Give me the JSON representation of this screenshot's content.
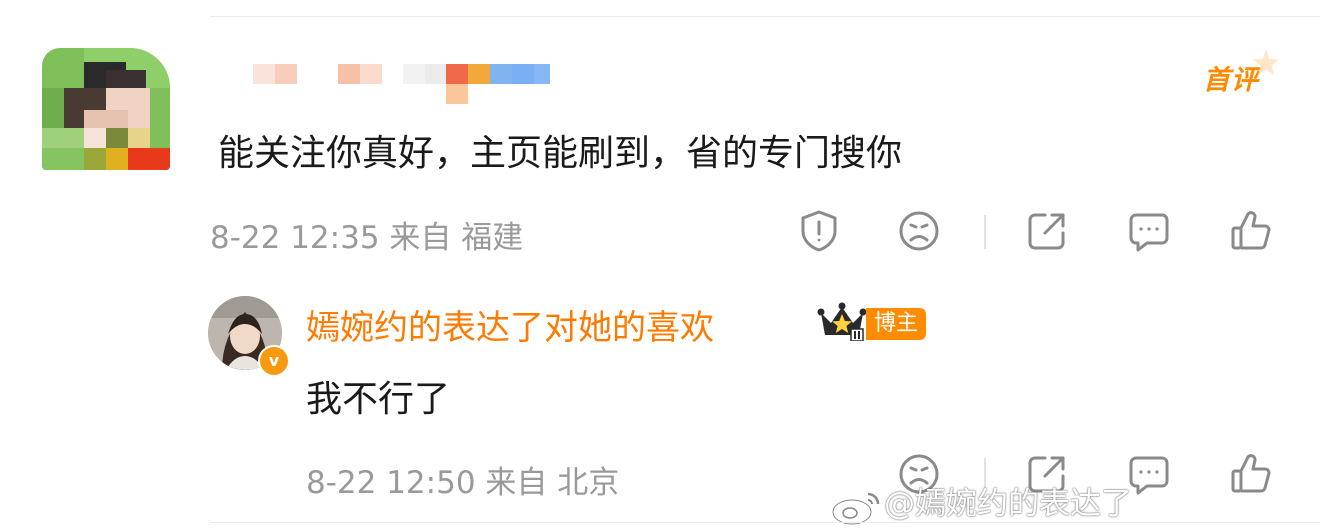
{
  "comment": {
    "badge": "首评",
    "text": "能关注你真好，主页能刷到，省的专门搜你",
    "date": "8-22 12:35",
    "from_label": "来自",
    "location": "福建"
  },
  "reply": {
    "username": "嫣婉约的表达了对她的喜欢",
    "tag": "博主",
    "verified_mark": "v",
    "text": "我不行了",
    "date": "8-22 12:50",
    "from_label": "来自",
    "location": "北京"
  },
  "watermark": {
    "text": "@嫣婉约的表达了"
  },
  "icons": {
    "comment_actions": [
      "report-icon",
      "dislike-icon",
      "share-icon",
      "comment-icon",
      "like-icon"
    ],
    "reply_actions": [
      "dislike-icon",
      "share-icon",
      "comment-icon",
      "like-icon"
    ]
  },
  "colors": {
    "accent": "#ff8a00",
    "username": "#ff7a00",
    "meta": "#9a9a9a",
    "icon": "#8a8a8a",
    "text": "#1a1a1a"
  }
}
